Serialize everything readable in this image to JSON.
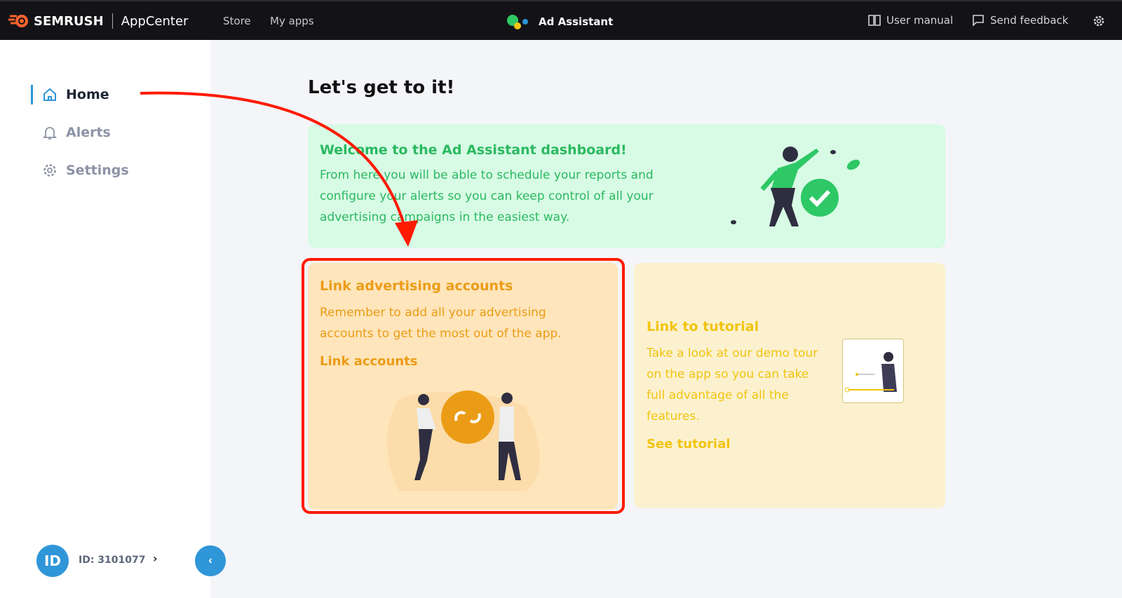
{
  "topbar": {
    "brand": "SEMRUSH",
    "appcenter": "AppCenter",
    "nav": [
      "Store",
      "My apps"
    ],
    "app_name": "Ad Assistant",
    "user_manual": "User manual",
    "send_feedback": "Send feedback"
  },
  "sidebar": {
    "items": [
      {
        "label": "Home",
        "icon": "home-icon",
        "active": true
      },
      {
        "label": "Alerts",
        "icon": "bell-icon"
      },
      {
        "label": "Settings",
        "icon": "gear-icon"
      }
    ],
    "avatar": "ID",
    "user_id": "ID: 3101077"
  },
  "main": {
    "title": "Let's get to it!",
    "welcome": {
      "title": "Welcome to the Ad Assistant dashboard!",
      "body": "From here you will be able to schedule your reports and configure your alerts so you can keep control of all your advertising campaigns in the easiest way."
    },
    "link_accounts": {
      "title": "Link advertising accounts",
      "body": "Remember to add all your advertising accounts to get the most out of the app.",
      "link": "Link accounts"
    },
    "tutorial": {
      "title": "Link to tutorial",
      "body": "Take a look at our demo tour on the app so you can take full advantage of all the features.",
      "link": "See tutorial"
    }
  },
  "colors": {
    "accent": "#2f96d8",
    "green": "#2ab960",
    "orange": "#eb9c16",
    "yellow": "#f1c40f",
    "highlight": "#ff1a00"
  }
}
